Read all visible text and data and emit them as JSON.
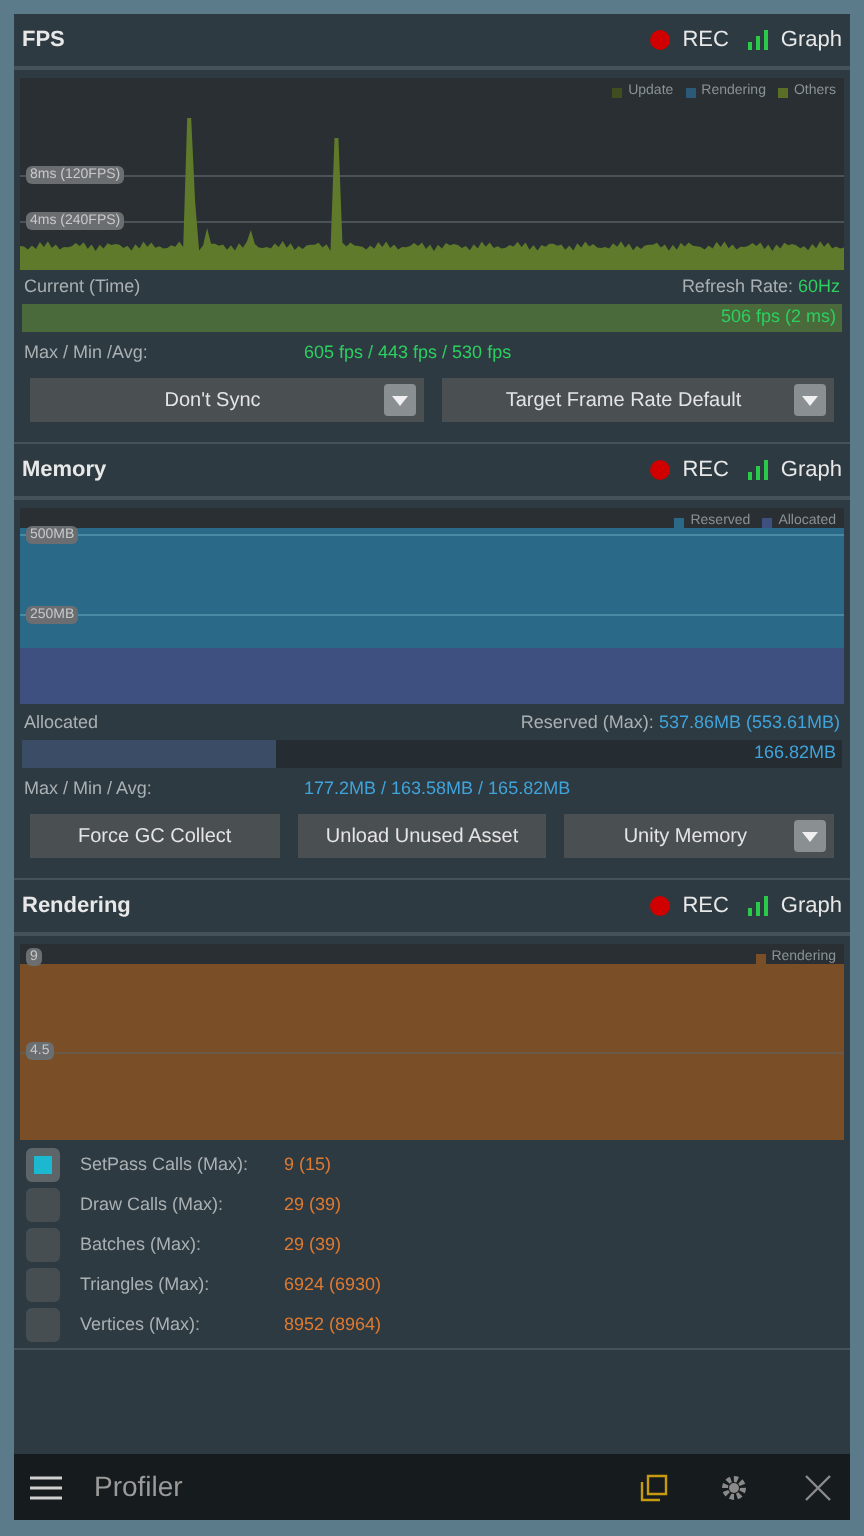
{
  "fps": {
    "header": {
      "title": "FPS",
      "rec": "REC",
      "graph": "Graph"
    },
    "legend": [
      {
        "label": "Update",
        "color": "#3f4d1f"
      },
      {
        "label": "Rendering",
        "color": "#2b5a78"
      },
      {
        "label": "Others",
        "color": "#5a6e28"
      }
    ],
    "gridlines": [
      "8ms (120FPS)",
      "4ms (240FPS)"
    ],
    "current_label": "Current (Time)",
    "refresh_label": "Refresh Rate:",
    "refresh_value": "60Hz",
    "current_value": "506 fps (2 ms)",
    "stats_label": "Max / Min /Avg:",
    "stats_value": "605 fps / 443 fps / 530 fps",
    "controls": [
      {
        "kind": "dropdown",
        "label": "Don't Sync"
      },
      {
        "kind": "dropdown",
        "label": "Target Frame Rate Default"
      }
    ]
  },
  "memory": {
    "header": {
      "title": "Memory",
      "rec": "REC",
      "graph": "Graph"
    },
    "legend": [
      {
        "label": "Reserved",
        "color": "#2a6a88"
      },
      {
        "label": "Allocated",
        "color": "#3e5080"
      }
    ],
    "gridlines": [
      "500MB",
      "250MB"
    ],
    "allocated_label": "Allocated",
    "reserved_label": "Reserved (Max):",
    "reserved_value": "537.86MB (553.61MB)",
    "level": 0.31,
    "current_value": "166.82MB",
    "stats_label": "Max / Min / Avg:",
    "stats_value": "177.2MB / 163.58MB / 165.82MB",
    "controls": [
      {
        "kind": "button",
        "label": "Force GC Collect"
      },
      {
        "kind": "button",
        "label": "Unload Unused Asset"
      },
      {
        "kind": "dropdown",
        "label": "Unity Memory"
      }
    ]
  },
  "rendering": {
    "header": {
      "title": "Rendering",
      "rec": "REC",
      "graph": "Graph"
    },
    "legend": [
      {
        "label": "Rendering",
        "color": "#7a4e26"
      }
    ],
    "gridlines": [
      "9",
      "4.5"
    ],
    "rows": [
      {
        "label": "SetPass Calls (Max):",
        "value": "9 (15)",
        "checked": true
      },
      {
        "label": "Draw Calls (Max):",
        "value": "29 (39)",
        "checked": false
      },
      {
        "label": "Batches (Max):",
        "value": "29 (39)",
        "checked": false
      },
      {
        "label": "Triangles (Max):",
        "value": "6924 (6930)",
        "checked": false
      },
      {
        "label": "Vertices (Max):",
        "value": "8952 (8964)",
        "checked": false
      }
    ]
  },
  "toolbar": {
    "title": "Profiler"
  }
}
